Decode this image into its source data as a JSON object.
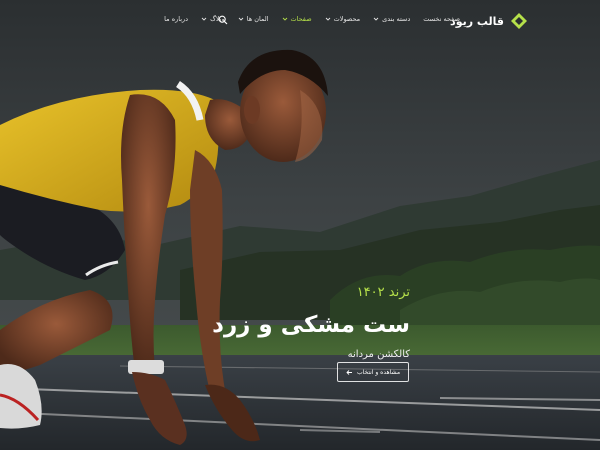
{
  "header": {
    "logo_text": "قالب ریود",
    "nav": [
      {
        "label": "صفحه نخست",
        "has_dropdown": false,
        "active": false
      },
      {
        "label": "دسته بندی",
        "has_dropdown": true,
        "active": false
      },
      {
        "label": "محصولات",
        "has_dropdown": true,
        "active": false
      },
      {
        "label": "صفحات",
        "has_dropdown": true,
        "active": true
      },
      {
        "label": "المان ها",
        "has_dropdown": true,
        "active": false
      },
      {
        "label": "وبلاگ",
        "has_dropdown": true,
        "active": false
      },
      {
        "label": "درباره ما",
        "has_dropdown": false,
        "active": false
      }
    ],
    "search_icon": "search-icon"
  },
  "hero": {
    "kicker": "ترند ۱۴۰۲",
    "title": "ست مشکی و زرد",
    "subtitle": "کالکشن مردانه",
    "cta_label": "مشاهده و انتخاب",
    "cta_icon": "arrow-left-icon"
  },
  "colors": {
    "accent": "#b5e04a",
    "text": "#ffffff",
    "jersey": "#e2b81e"
  }
}
